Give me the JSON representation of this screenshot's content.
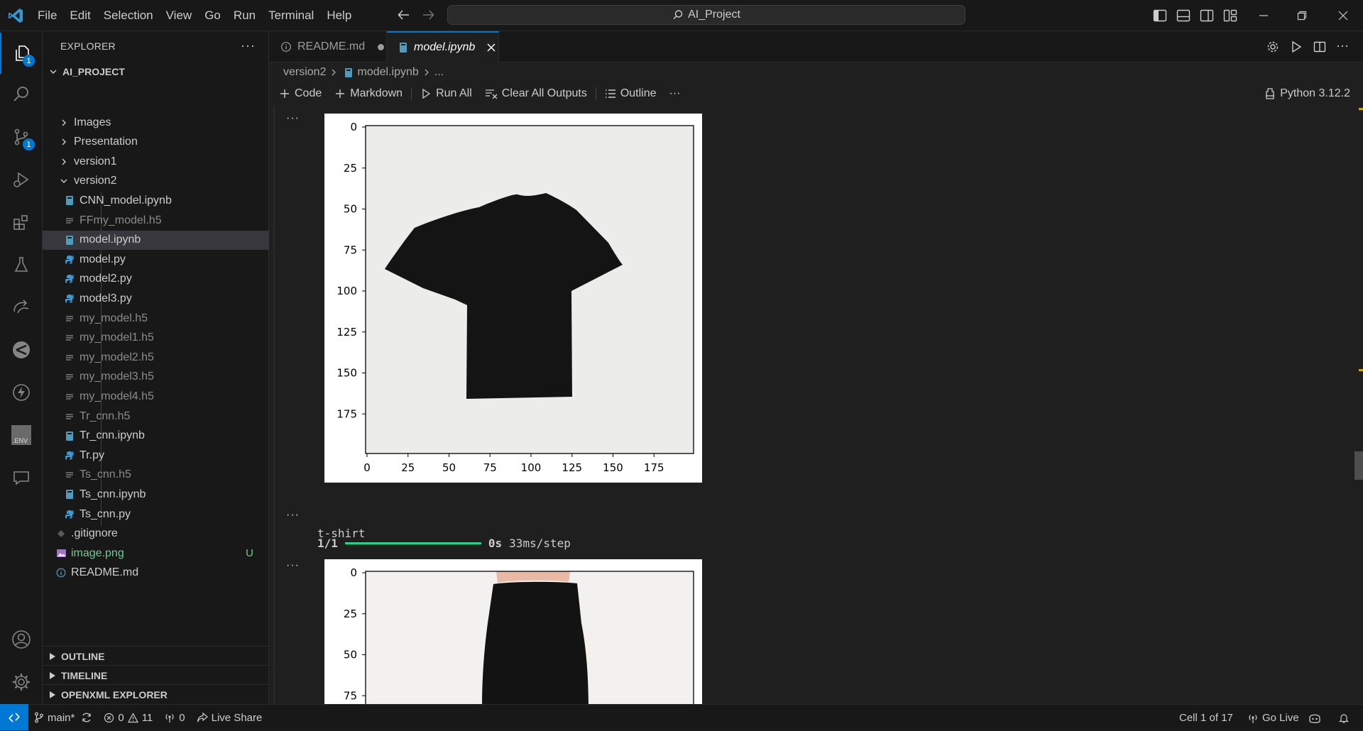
{
  "titlebar": {
    "menu": [
      "File",
      "Edit",
      "Selection",
      "View",
      "Go",
      "Run",
      "Terminal",
      "Help"
    ],
    "search_text": "AI_Project"
  },
  "activity_bar": {
    "explorer_badge": "1",
    "scm_badge": "1",
    "env_label": ".ENV"
  },
  "explorer": {
    "title": "EXPLORER",
    "more": "···",
    "project": "AI_PROJECT",
    "tree": [
      {
        "label": "Images",
        "type": "folder"
      },
      {
        "label": "Presentation",
        "type": "folder"
      },
      {
        "label": "version1",
        "type": "folder"
      },
      {
        "label": "version2",
        "type": "folder-open"
      },
      {
        "label": "CNN_model.ipynb",
        "type": "notebook"
      },
      {
        "label": "FFmy_model.h5",
        "type": "h5"
      },
      {
        "label": "model.ipynb",
        "type": "notebook"
      },
      {
        "label": "model.py",
        "type": "python"
      },
      {
        "label": "model2.py",
        "type": "python"
      },
      {
        "label": "model3.py",
        "type": "python"
      },
      {
        "label": "my_model.h5",
        "type": "h5"
      },
      {
        "label": "my_model1.h5",
        "type": "h5"
      },
      {
        "label": "my_model2.h5",
        "type": "h5"
      },
      {
        "label": "my_model3.h5",
        "type": "h5"
      },
      {
        "label": "my_model4.h5",
        "type": "h5"
      },
      {
        "label": "Tr_cnn.h5",
        "type": "h5"
      },
      {
        "label": "Tr_cnn.ipynb",
        "type": "notebook"
      },
      {
        "label": "Tr.py",
        "type": "python"
      },
      {
        "label": "Ts_cnn.h5",
        "type": "h5"
      },
      {
        "label": "Ts_cnn.ipynb",
        "type": "notebook"
      },
      {
        "label": "Ts_cnn.py",
        "type": "python"
      },
      {
        "label": ".gitignore",
        "type": "git"
      },
      {
        "label": "image.png",
        "type": "image",
        "status": "U"
      },
      {
        "label": "README.md",
        "type": "info"
      }
    ],
    "selected": "model.ipynb",
    "sections": [
      "OUTLINE",
      "TIMELINE",
      "OPENXML EXPLORER"
    ]
  },
  "tabs": [
    {
      "label": "README.md",
      "dirty": true
    },
    {
      "label": "model.ipynb",
      "active": true
    }
  ],
  "breadcrumb": {
    "folder": "version2",
    "file": "model.ipynb",
    "tail": "..."
  },
  "toolbar": {
    "code": "Code",
    "markdown": "Markdown",
    "run_all": "Run All",
    "clear_outputs": "Clear All Outputs",
    "outline": "Outline",
    "more": "···",
    "kernel": "Python 3.12.2"
  },
  "cells": {
    "more": "···",
    "plot1": {
      "y_ticks": [
        "0",
        "25",
        "50",
        "75",
        "100",
        "125",
        "150",
        "175"
      ],
      "x_ticks": [
        "0",
        "25",
        "50",
        "75",
        "100",
        "125",
        "150",
        "175"
      ]
    },
    "progress": {
      "step": "1/1",
      "time": "0s",
      "rate": "33ms/step",
      "fraction": 1.0
    },
    "prediction": "t-shirt",
    "plot2": {
      "y_ticks": [
        "0",
        "25",
        "50",
        "75"
      ]
    }
  },
  "statusbar": {
    "branch": "main*",
    "errors": "0",
    "warnings": "11",
    "ports": "0",
    "live_share": "Live Share",
    "cell": "Cell 1 of 17",
    "go_live": "Go Live"
  },
  "colors": {
    "accent": "#0078d4",
    "untracked": "#73c991",
    "progress": "#23d18b",
    "folder_icon": "#cccccc",
    "notebook_icon": "#519aba",
    "python_icon": "#3b9bd6"
  }
}
